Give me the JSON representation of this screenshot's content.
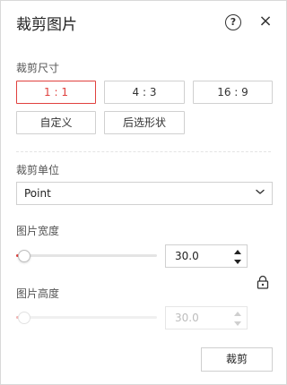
{
  "header": {
    "title": "裁剪图片",
    "help_label": "?",
    "close_label": "×"
  },
  "crop_size": {
    "label": "裁剪尺寸",
    "ratios": [
      "1 : 1",
      "4 : 3",
      "16 : 9"
    ],
    "selected": "1 : 1",
    "custom_label": "自定义",
    "shape_label": "后选形状"
  },
  "unit": {
    "label": "裁剪单位",
    "value": "Point"
  },
  "width": {
    "label": "图片宽度",
    "value": "30.0",
    "slider_fraction": 0.0
  },
  "height": {
    "label": "图片高度",
    "value": "30.0",
    "slider_fraction": 0.0,
    "disabled": true
  },
  "actions": {
    "crop_label": "裁剪"
  },
  "colors": {
    "accent": "#e0413e",
    "border": "#d0d0d0",
    "text": "#333333"
  },
  "icons": [
    "help-icon",
    "close-icon",
    "chevron-down-icon",
    "lock-icon",
    "spin-up-icon",
    "spin-down-icon"
  ]
}
